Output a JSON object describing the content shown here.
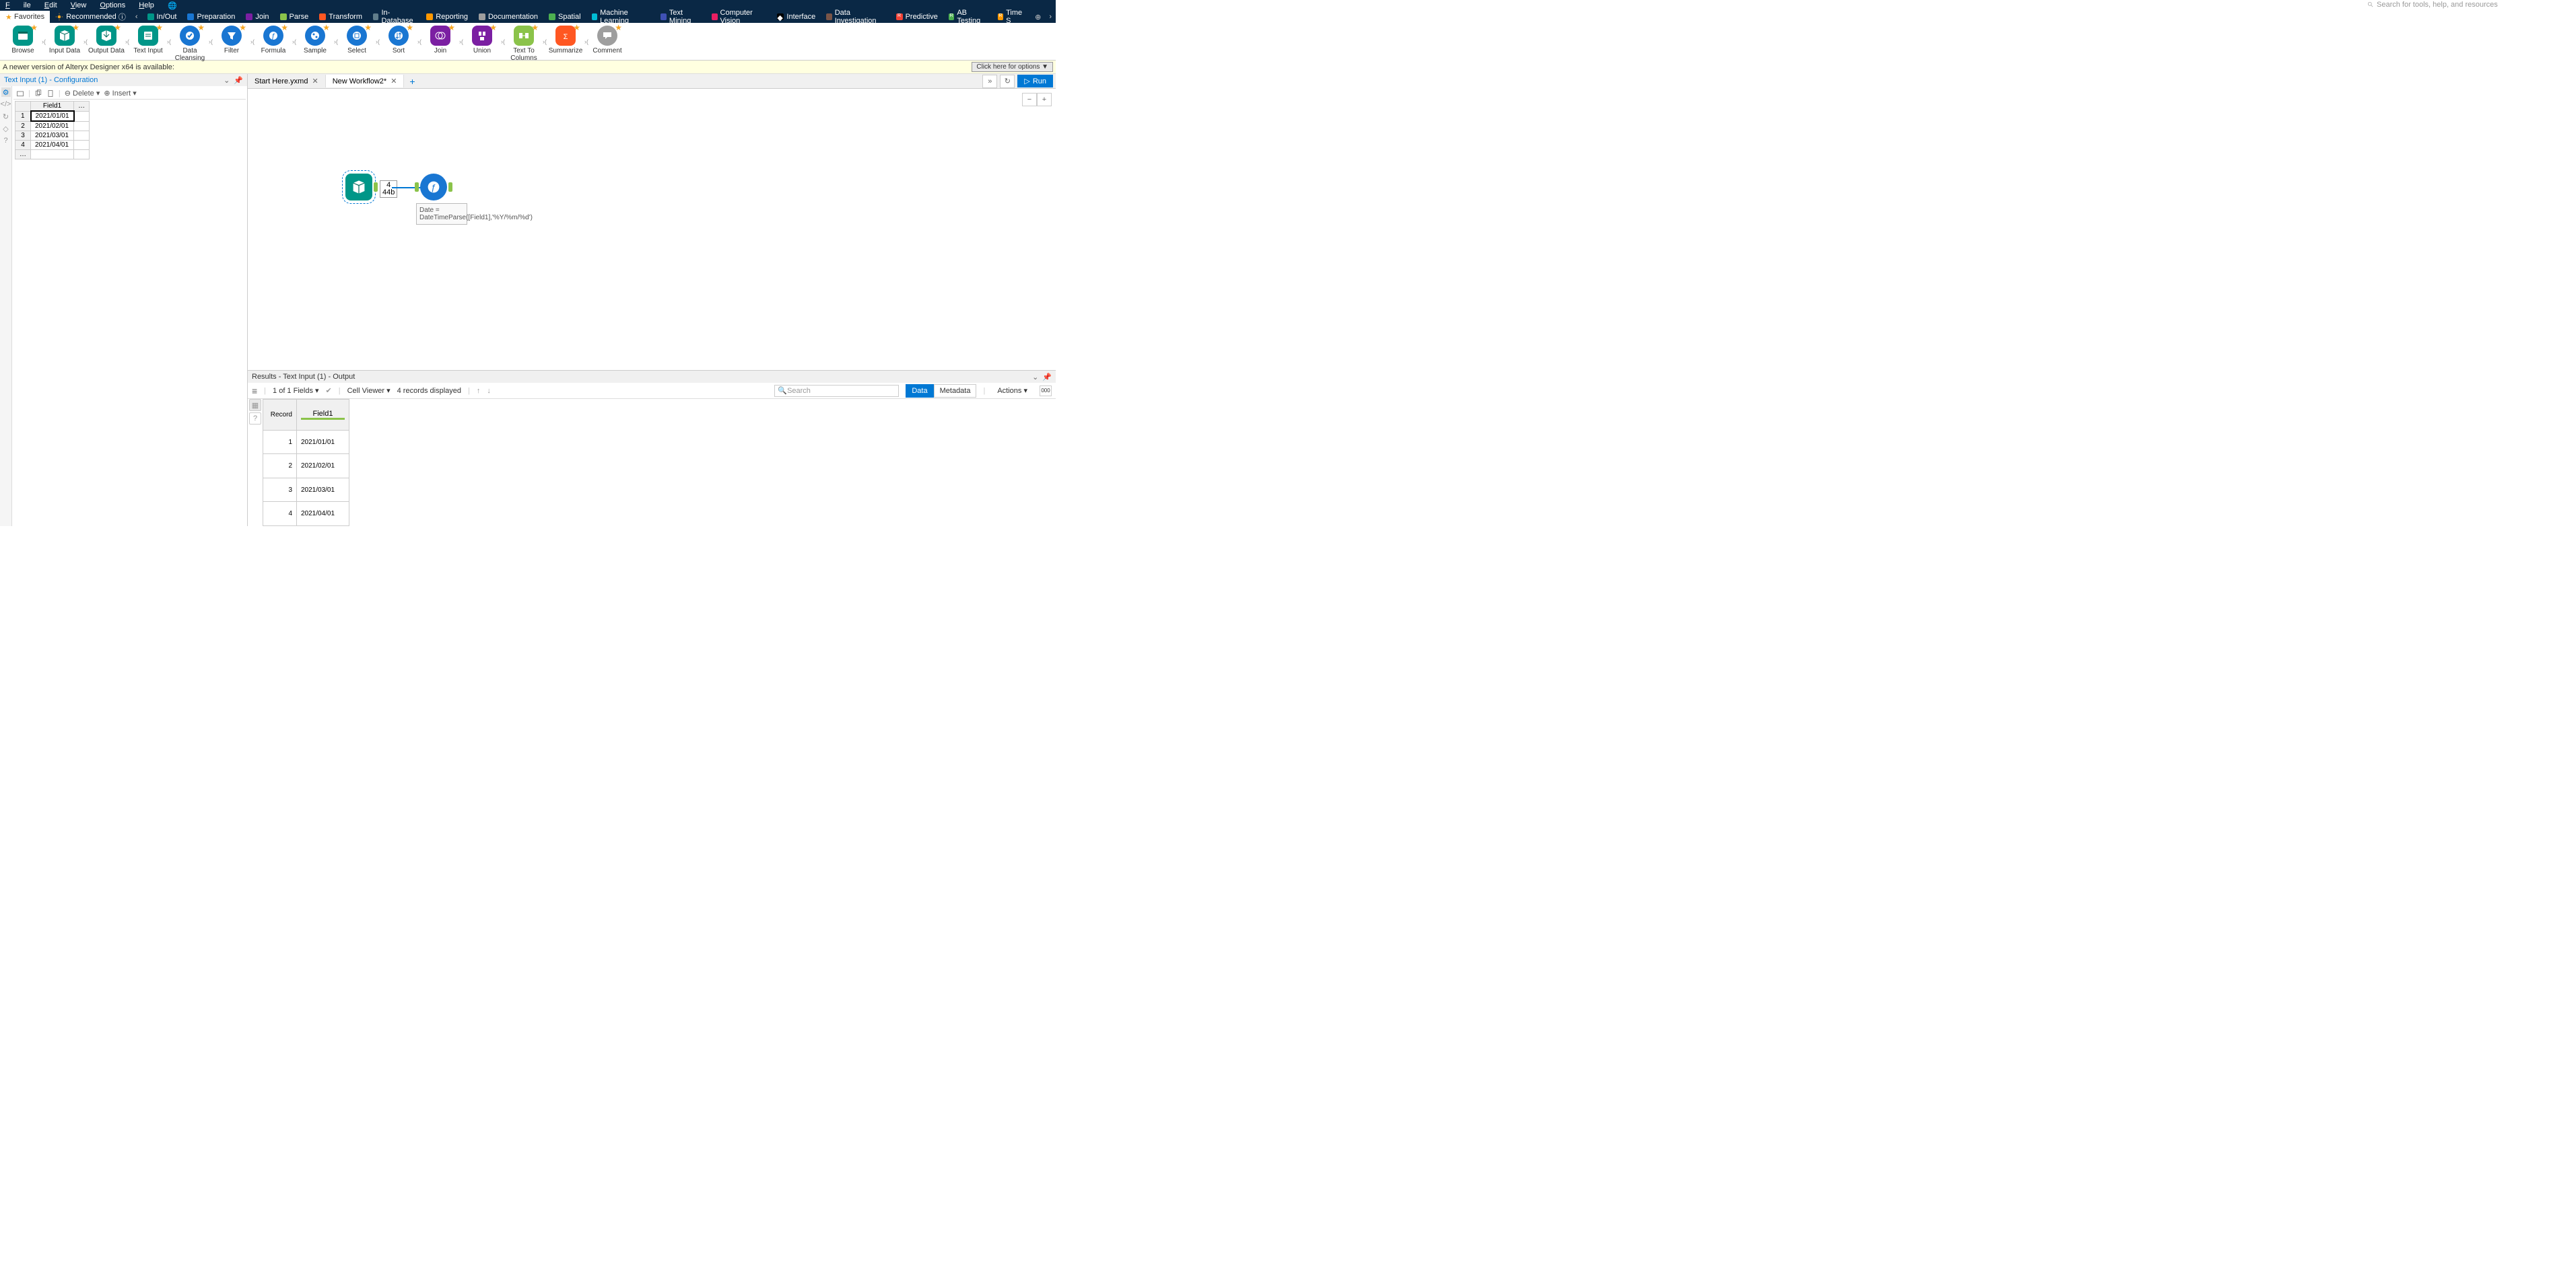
{
  "menu": {
    "file": "File",
    "edit": "Edit",
    "view": "View",
    "options": "Options",
    "help": "Help"
  },
  "search_placeholder": "Search for tools, help, and resources",
  "ribbon": {
    "favorites": "Favorites",
    "recommended": "Recommended",
    "cats": [
      "In/Out",
      "Preparation",
      "Join",
      "Parse",
      "Transform",
      "In-Database",
      "Reporting",
      "Documentation",
      "Spatial",
      "Machine Learning",
      "Text Mining",
      "Computer Vision",
      "Interface",
      "Data Investigation",
      "Predictive",
      "AB Testing",
      "Time S"
    ]
  },
  "tools": [
    "Browse",
    "Input Data",
    "Output Data",
    "Text Input",
    "Data Cleansing",
    "Filter",
    "Formula",
    "Sample",
    "Select",
    "Sort",
    "Join",
    "Union",
    "Text To Columns",
    "Summarize",
    "Comment"
  ],
  "notice": {
    "msg": "A newer version of Alteryx Designer x64 is available:",
    "btn": "Click here for options ▼"
  },
  "config": {
    "title": "Text Input (1) - Configuration",
    "delete": "Delete",
    "insert": "Insert",
    "header": "Field1",
    "rows": [
      "2021/01/01",
      "2021/02/01",
      "2021/03/01",
      "2021/04/01"
    ]
  },
  "tabs": {
    "t1": "Start Here.yxmd",
    "t2": "New Workflow2*"
  },
  "run": "Run",
  "canvas": {
    "badge1": "4",
    "badge2": "44b",
    "annot": "Date = DateTimeParse([Field1],'%Y/%m/%d')"
  },
  "results": {
    "title": "Results - Text Input (1) - Output",
    "fields": "1 of 1 Fields",
    "cell": "Cell Viewer",
    "rec": "4 records displayed",
    "search": "Search",
    "data": "Data",
    "meta": "Metadata",
    "actions": "Actions",
    "box": "000",
    "h1": "Record",
    "h2": "Field1",
    "rows": [
      [
        "1",
        "2021/01/01"
      ],
      [
        "2",
        "2021/02/01"
      ],
      [
        "3",
        "2021/03/01"
      ],
      [
        "4",
        "2021/04/01"
      ]
    ]
  }
}
